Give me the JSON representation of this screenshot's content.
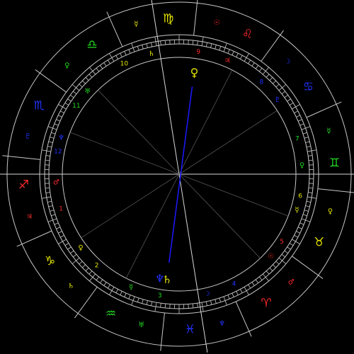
{
  "chart_data": {
    "type": "natal-wheel",
    "colors": {
      "background": "#000000",
      "lines": "#c8c8c8",
      "fire": "#ff2a2a",
      "earth": "#e6e600",
      "air": "#22dd22",
      "water": "#2233ff",
      "aspect_line": "#1a1aff"
    },
    "signs": [
      {
        "name": "leo",
        "glyph": "♌",
        "element": "fire"
      },
      {
        "name": "cancer",
        "glyph": "♋",
        "element": "water"
      },
      {
        "name": "gemini",
        "glyph": "♊",
        "element": "air"
      },
      {
        "name": "taurus",
        "glyph": "♉",
        "element": "earth"
      },
      {
        "name": "aries",
        "glyph": "♈",
        "element": "fire"
      },
      {
        "name": "pisces",
        "glyph": "♓",
        "element": "water"
      },
      {
        "name": "aquarius",
        "glyph": "♒",
        "element": "air"
      },
      {
        "name": "capricorn",
        "glyph": "♑",
        "element": "earth"
      },
      {
        "name": "sagittarius",
        "glyph": "♐",
        "element": "fire"
      },
      {
        "name": "scorpio",
        "glyph": "♏",
        "element": "water"
      },
      {
        "name": "libra",
        "glyph": "♎",
        "element": "air"
      },
      {
        "name": "virgo",
        "glyph": "♍",
        "element": "earth"
      }
    ],
    "sign_rulers": [
      {
        "sign": "leo",
        "glyph": "☉",
        "element": "fire"
      },
      {
        "sign": "cancer",
        "glyph": "☽",
        "element": "water"
      },
      {
        "sign": "gemini",
        "glyph": "☿",
        "element": "air"
      },
      {
        "sign": "taurus",
        "glyph": "♀",
        "element": "earth"
      },
      {
        "sign": "aries",
        "glyph": "♂",
        "element": "fire"
      },
      {
        "sign": "pisces",
        "glyph": "♆",
        "element": "water"
      },
      {
        "sign": "aquarius",
        "glyph": "♅",
        "element": "air"
      },
      {
        "sign": "capricorn",
        "glyph": "♄",
        "element": "earth"
      },
      {
        "sign": "sagittarius",
        "glyph": "♃",
        "element": "fire"
      },
      {
        "sign": "scorpio",
        "glyph": "♇",
        "element": "water"
      },
      {
        "sign": "libra",
        "glyph": "♀",
        "element": "air"
      },
      {
        "sign": "virgo",
        "glyph": "☿",
        "element": "earth"
      }
    ],
    "houses": [
      {
        "number": "1",
        "cusp_glyph": "♂",
        "element": "fire"
      },
      {
        "number": "2",
        "cusp_glyph": "♀",
        "element": "earth"
      },
      {
        "number": "3",
        "cusp_glyph": "☿",
        "element": "air"
      },
      {
        "number": "4",
        "cusp_glyph": "☽",
        "element": "water"
      },
      {
        "number": "5",
        "cusp_glyph": "☉",
        "element": "fire"
      },
      {
        "number": "6",
        "cusp_glyph": "☿",
        "element": "earth"
      },
      {
        "number": "7",
        "cusp_glyph": "♀",
        "element": "air"
      },
      {
        "number": "8",
        "cusp_glyph": "♇",
        "element": "water"
      },
      {
        "number": "9",
        "cusp_glyph": "♃",
        "element": "fire"
      },
      {
        "number": "10",
        "cusp_glyph": "♄",
        "element": "earth"
      },
      {
        "number": "11",
        "cusp_glyph": "♅",
        "element": "air"
      },
      {
        "number": "12",
        "cusp_glyph": "♆",
        "element": "water"
      }
    ],
    "planets": [
      {
        "name": "venus",
        "glyph": "♀",
        "color": "#e6e600"
      },
      {
        "name": "saturn",
        "glyph": "♄",
        "color": "#e6e600"
      },
      {
        "name": "neptune",
        "glyph": "♆",
        "color": "#2233ff"
      }
    ],
    "aspects": [
      {
        "from": "venus",
        "to": "saturn",
        "color": "#1a1aff"
      }
    ]
  }
}
